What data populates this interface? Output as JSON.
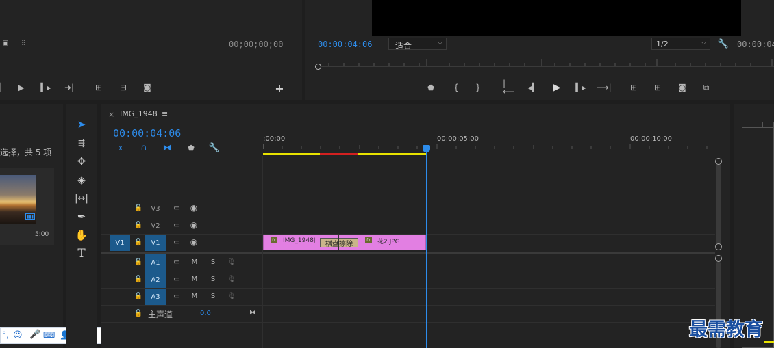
{
  "source_monitor": {
    "timecode": "00;00;00;00"
  },
  "program_monitor": {
    "timecode": "00:00:04:06",
    "fit_label": "适合",
    "resolution": "1/2",
    "end_timecode": "00:00:04"
  },
  "project_panel": {
    "selection_text": "选择，共 5 项",
    "thumb_duration": "5:00"
  },
  "timeline": {
    "tab_close": "×",
    "tab_title": "IMG_1948",
    "tab_menu": "≡",
    "timecode": "00:00:04:06",
    "ruler_labels": [
      ":00:00",
      "00:00:05:00",
      "00:00:10:00"
    ],
    "tracks": [
      {
        "source": "",
        "name": "V3"
      },
      {
        "source": "",
        "name": "V2"
      },
      {
        "source": "V1",
        "name": "V1"
      },
      {
        "source": "",
        "name": "A1"
      },
      {
        "source": "",
        "name": "A2"
      },
      {
        "source": "",
        "name": "A3"
      }
    ],
    "track_m": "M",
    "track_s": "S",
    "master_label": "主声道",
    "master_value": "0.0",
    "clips": [
      {
        "name": "IMG_1948J",
        "fx": "fx"
      },
      {
        "name": "花2.JPG",
        "fx": "fx"
      }
    ],
    "transition_label": "棋盘擦除"
  },
  "watermark": "最需教育",
  "colors": {
    "accent": "#2d8ceb",
    "clip": "#e27fe2",
    "track_on": "#1c5a8c",
    "render_yellow": "#e8e200",
    "render_red": "#d32020"
  }
}
